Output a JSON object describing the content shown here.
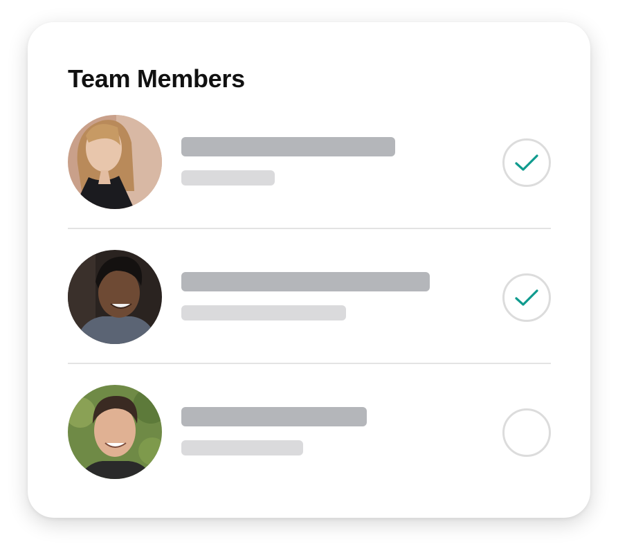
{
  "card": {
    "title": "Team Members"
  },
  "members": [
    {
      "checked": true
    },
    {
      "checked": true
    },
    {
      "checked": false
    }
  ],
  "colors": {
    "check_accent": "#0f9b8e",
    "bar_primary": "#b4b6ba",
    "bar_secondary": "#dadadc"
  }
}
